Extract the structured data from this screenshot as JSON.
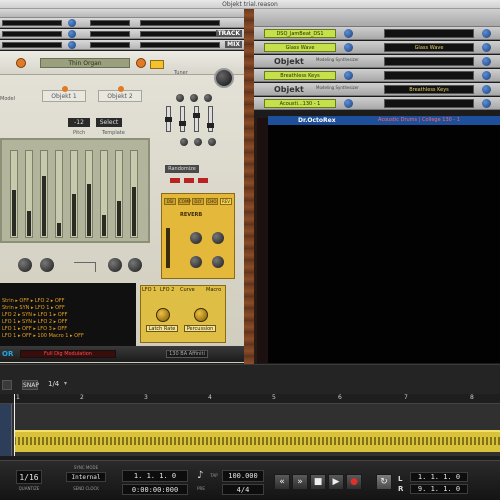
{
  "window": {
    "title": "Objekt trial.reason"
  },
  "left_rack": {
    "track_label": "TRACK",
    "mix_label": "MIX"
  },
  "synth": {
    "patch_name": "Thin Organ",
    "tune_label": "Tuner",
    "model_label": "Model",
    "tab1": "Objekt 1",
    "tab2": "Objekt 2",
    "pitch_value": "-12",
    "select_label": "Select",
    "pitch_label": "Pitch",
    "template_label": "Template",
    "drawbars": [
      0.55,
      0.3,
      0.72,
      0.15,
      0.5,
      0.62,
      0.25,
      0.42,
      0.58
    ],
    "randomizer_label": "Randomize",
    "reverb_label": "REVERB",
    "reverb_tabs": [
      "DSI",
      "COMP",
      "DLY",
      "CHO",
      "REV"
    ],
    "mod_rows": [
      "Strin  ▸ OFF   ▸ LFO 2    ▸ OFF",
      "Strin  ▸ SYN   ▸ LFO 1    ▸ OFF",
      "LFO 2  ▸ SYN   ▸ LFO 1    ▸ OFF",
      "LFO 1  ▸ SYN   ▸ LFO 2    ▸ OFF",
      "LFO 1  ▸ OFF   ▸ LFO 3    ▸ OFF",
      "LFO 1  ▸ OFF   ▸ 100 Macro 1 ▸ OFF"
    ],
    "lfo_labels": {
      "lfo1": "LFO 1",
      "lfo2": "LFO 2",
      "curve": "Curve",
      "macro": "Macro"
    },
    "latch_label": "Latch Rate",
    "percussion_label": "Percussion",
    "bottom_lcd": "Full Dig Modulation",
    "bottom_lcd2": "130 BA Affiniti",
    "logo": "OR"
  },
  "right_rack": {
    "strips": [
      {
        "name": "DSQ_JamBeat_DS1",
        "lcd": ""
      },
      {
        "name": "Glass Wave",
        "lcd": "Glass Wave"
      },
      {
        "brand": "Objekt",
        "sub": "Modeling Synthesizer"
      },
      {
        "name": "Breathless Keys",
        "lcd": ""
      },
      {
        "brand": "Objekt",
        "sub": "Modeling Synthesizer",
        "lcd": "Breathless Keys"
      },
      {
        "name": "Acousti...130 - 1",
        "lcd": ""
      }
    ],
    "octo_logo": "Dr.OctoRex",
    "octo_lcd": "Acoustic Drums | College 130 - 1"
  },
  "sequencer": {
    "toolbar_btn": "SNAP",
    "quant": "1/4",
    "ruler_marks": [
      "1",
      "2",
      "3",
      "4",
      "5",
      "6",
      "7",
      "8"
    ]
  },
  "transport": {
    "quantize_value": "1/16",
    "quantize_label": "QUANTIZE",
    "sync_label": "SYNC MODE",
    "sync_value": "Internal",
    "send_clock": "SEND CLOCK",
    "position": "1. 1. 1. 0",
    "time": "0:00:00:000",
    "tempo": "100.000",
    "signature": "4/4",
    "tap_label": "TAP",
    "pre_label": "PRE",
    "left_locator": "1. 1. 1. 0",
    "right_locator": "9. 1. 1. 0",
    "L": "L",
    "R": "R",
    "rewind": "«",
    "forward": "»",
    "stop": "■",
    "play": "▶",
    "record": "●",
    "loop": "↻"
  }
}
